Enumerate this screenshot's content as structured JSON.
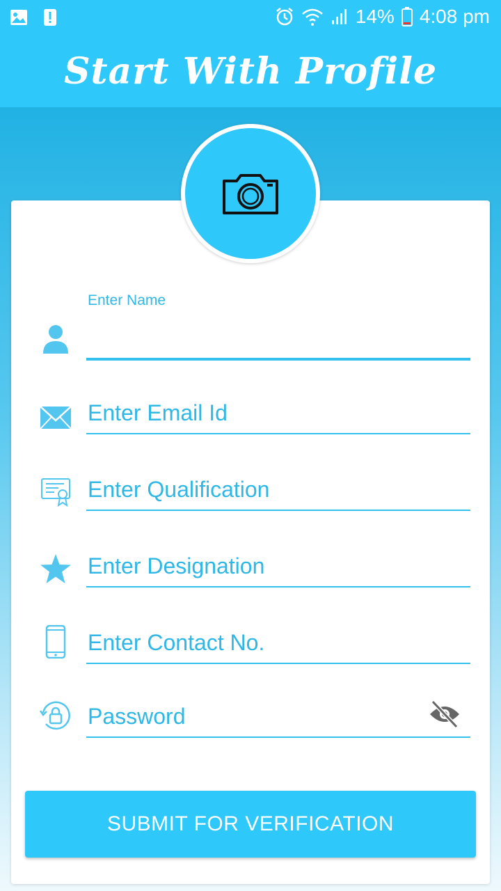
{
  "status_bar": {
    "battery": "14%",
    "time": "4:08 pm",
    "icons": [
      "gallery-icon",
      "alert-icon",
      "alarm-icon",
      "wifi-icon",
      "signal-icon",
      "battery-icon"
    ]
  },
  "app_bar": {
    "title": "Start With Profile"
  },
  "profile_photo": {
    "icon": "camera-icon"
  },
  "form": {
    "name": {
      "label": "Enter Name",
      "value": "",
      "icon": "person-icon"
    },
    "email": {
      "placeholder": "Enter Email Id",
      "icon": "envelope-icon"
    },
    "qualification": {
      "placeholder": "Enter Qualification",
      "icon": "certificate-icon"
    },
    "designation": {
      "placeholder": "Enter Designation",
      "icon": "star-icon"
    },
    "contact": {
      "placeholder": "Enter Contact No.",
      "icon": "phone-icon"
    },
    "password": {
      "placeholder": "Password",
      "icon": "lock-icon",
      "toggle_icon": "eye-off-icon"
    }
  },
  "submit": {
    "label": "SUBMIT FOR VERIFICATION"
  },
  "colors": {
    "primary": "#2fc8fb",
    "accent_text": "#2fb7e6",
    "card": "#ffffff"
  }
}
